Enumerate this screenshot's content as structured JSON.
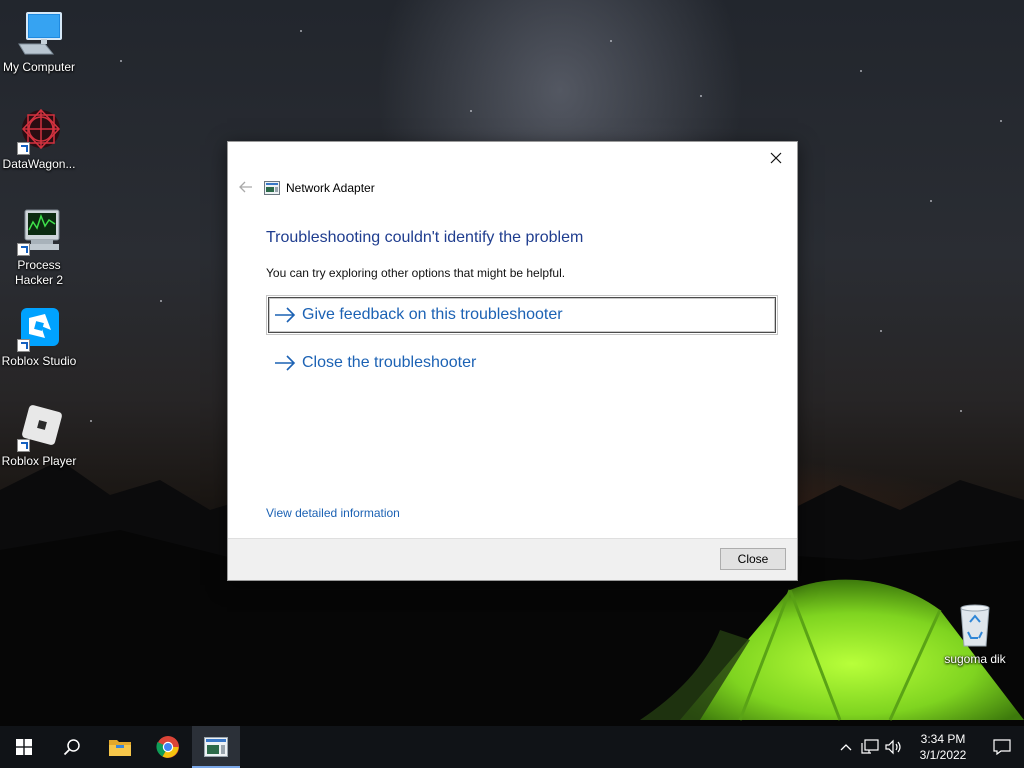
{
  "desktop": {
    "icons": [
      {
        "label": "My Computer",
        "icon": "computer-icon"
      },
      {
        "label": "DataWagon...",
        "icon": "datawagon-icon"
      },
      {
        "label": "Process Hacker 2",
        "icon": "process-hacker-icon"
      },
      {
        "label": "Roblox Studio",
        "icon": "roblox-studio-icon"
      },
      {
        "label": "Roblox Player",
        "icon": "roblox-player-icon"
      },
      {
        "label": "sugoma dik",
        "icon": "recycle-bin-icon"
      }
    ]
  },
  "dialog": {
    "nav_title": "Network Adapter",
    "heading": "Troubleshooting couldn't identify the problem",
    "subtext": "You can try exploring other options that might be helpful.",
    "options": [
      {
        "label": "Give feedback on this troubleshooter",
        "focused": true
      },
      {
        "label": "Close the troubleshooter",
        "focused": false
      }
    ],
    "details_link": "View detailed information",
    "close_button": "Close",
    "link_color": "#1c62b4",
    "heading_color": "#1f3d8f"
  },
  "taskbar": {
    "clock_time": "3:34 PM",
    "clock_date": "3/1/2022",
    "pinned": [
      "start-icon",
      "search-icon",
      "file-explorer-icon",
      "chrome-icon",
      "troubleshooter-icon"
    ],
    "active_app": "troubleshooter-icon",
    "accent": "#7aa7e8"
  }
}
